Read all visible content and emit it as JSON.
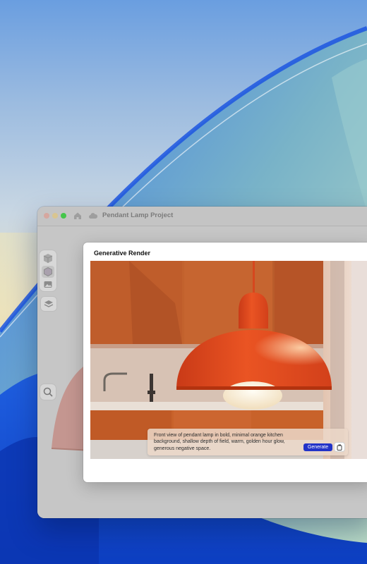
{
  "window": {
    "title": "Pendant Lamp Project"
  },
  "dialog": {
    "title": "Generative Render",
    "prompt": "Front view of pendant lamp in bold, minimal orange kitchen background, shallow depth of field, warm, golden hour glow, generous negative space.",
    "generate_label": "Generate"
  },
  "colors": {
    "accent": "#2233c8",
    "lamp": "#e0491f",
    "kitchen": "#c8622a"
  },
  "icons": [
    "home-icon",
    "cloud-icon",
    "cube-icon",
    "hexagon-icon",
    "image-icon",
    "layers-icon",
    "search-icon",
    "copy-icon"
  ]
}
